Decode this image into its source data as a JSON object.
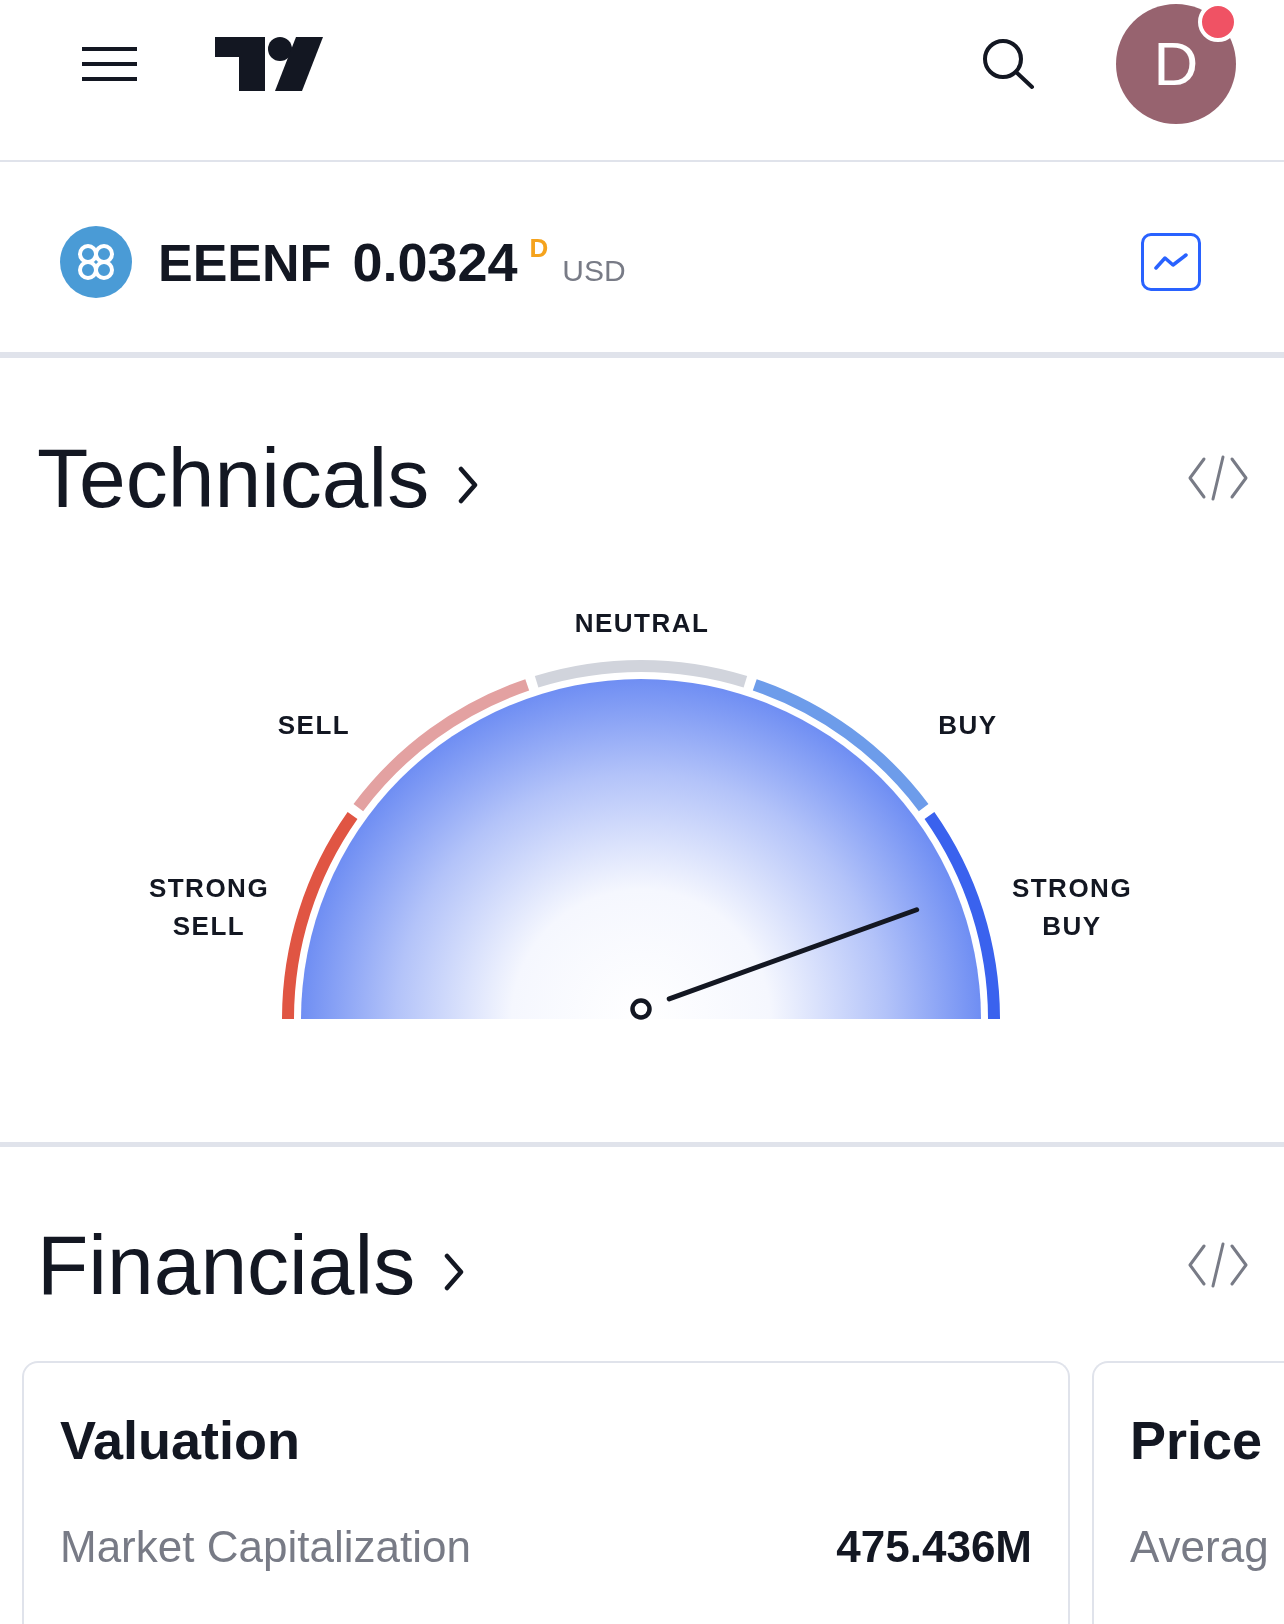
{
  "header": {
    "avatar": {
      "letter": "D",
      "unread": true
    }
  },
  "symbol": {
    "ticker": "EEENF",
    "price": "0.0324",
    "price_flag": "D",
    "currency": "USD"
  },
  "technicals": {
    "title": "Technicals",
    "gauge": {
      "level": 0.89,
      "segments": [
        {
          "label": "STRONG SELL",
          "color": "#e05543"
        },
        {
          "label": "SELL",
          "color": "#e3a1a1"
        },
        {
          "label": "NEUTRAL",
          "color": "#d1d4dc"
        },
        {
          "label": "BUY",
          "color": "#6d9cea"
        },
        {
          "label": "STRONG BUY",
          "color": "#3a62ee"
        }
      ]
    }
  },
  "financials": {
    "title": "Financials",
    "cards": [
      {
        "title": "Valuation",
        "rows": [
          {
            "label": "Market Capitalization",
            "value": "475.436M"
          }
        ]
      },
      {
        "title": "Price",
        "rows": [
          {
            "label": "Averag"
          }
        ]
      }
    ]
  }
}
